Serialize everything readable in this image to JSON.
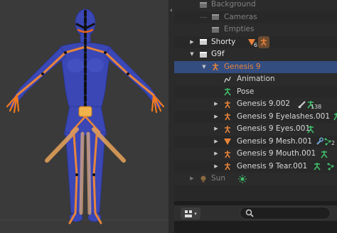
{
  "outliner": {
    "rows": {
      "background": "Background",
      "cameras": "Cameras",
      "empties": "Empties",
      "shorty": "Shorty",
      "shorty_tag": "6",
      "g9f": "G9f",
      "genesis9": "Genesis 9",
      "animation": "Animation",
      "pose": "Pose",
      "genesis9002": "Genesis 9.002",
      "genesis9002_tag": "138",
      "eyelashes": "Genesis 9 Eyelashes.001",
      "eyes": "Genesis 9 Eyes.001",
      "mesh": "Genesis 9 Mesh.001",
      "mesh_tag": "2",
      "mouth": "Genesis 9 Mouth.001",
      "tear": "Genesis 9 Tear.001",
      "sun": "Sun"
    }
  },
  "bottom": {
    "search_placeholder": ""
  },
  "colors": {
    "selection": "#334d80",
    "armature_orange": "#e8843a",
    "mesh_blue": "#3a47b5",
    "bone_orange": "#f07a1e",
    "pose_green": "#3fbf6a"
  },
  "icons": {
    "collection": "collection-icon",
    "armature": "armature-icon",
    "mesh": "mesh-icon",
    "light": "light-icon",
    "search": "search-icon",
    "display_mode": "display-mode-icon"
  }
}
